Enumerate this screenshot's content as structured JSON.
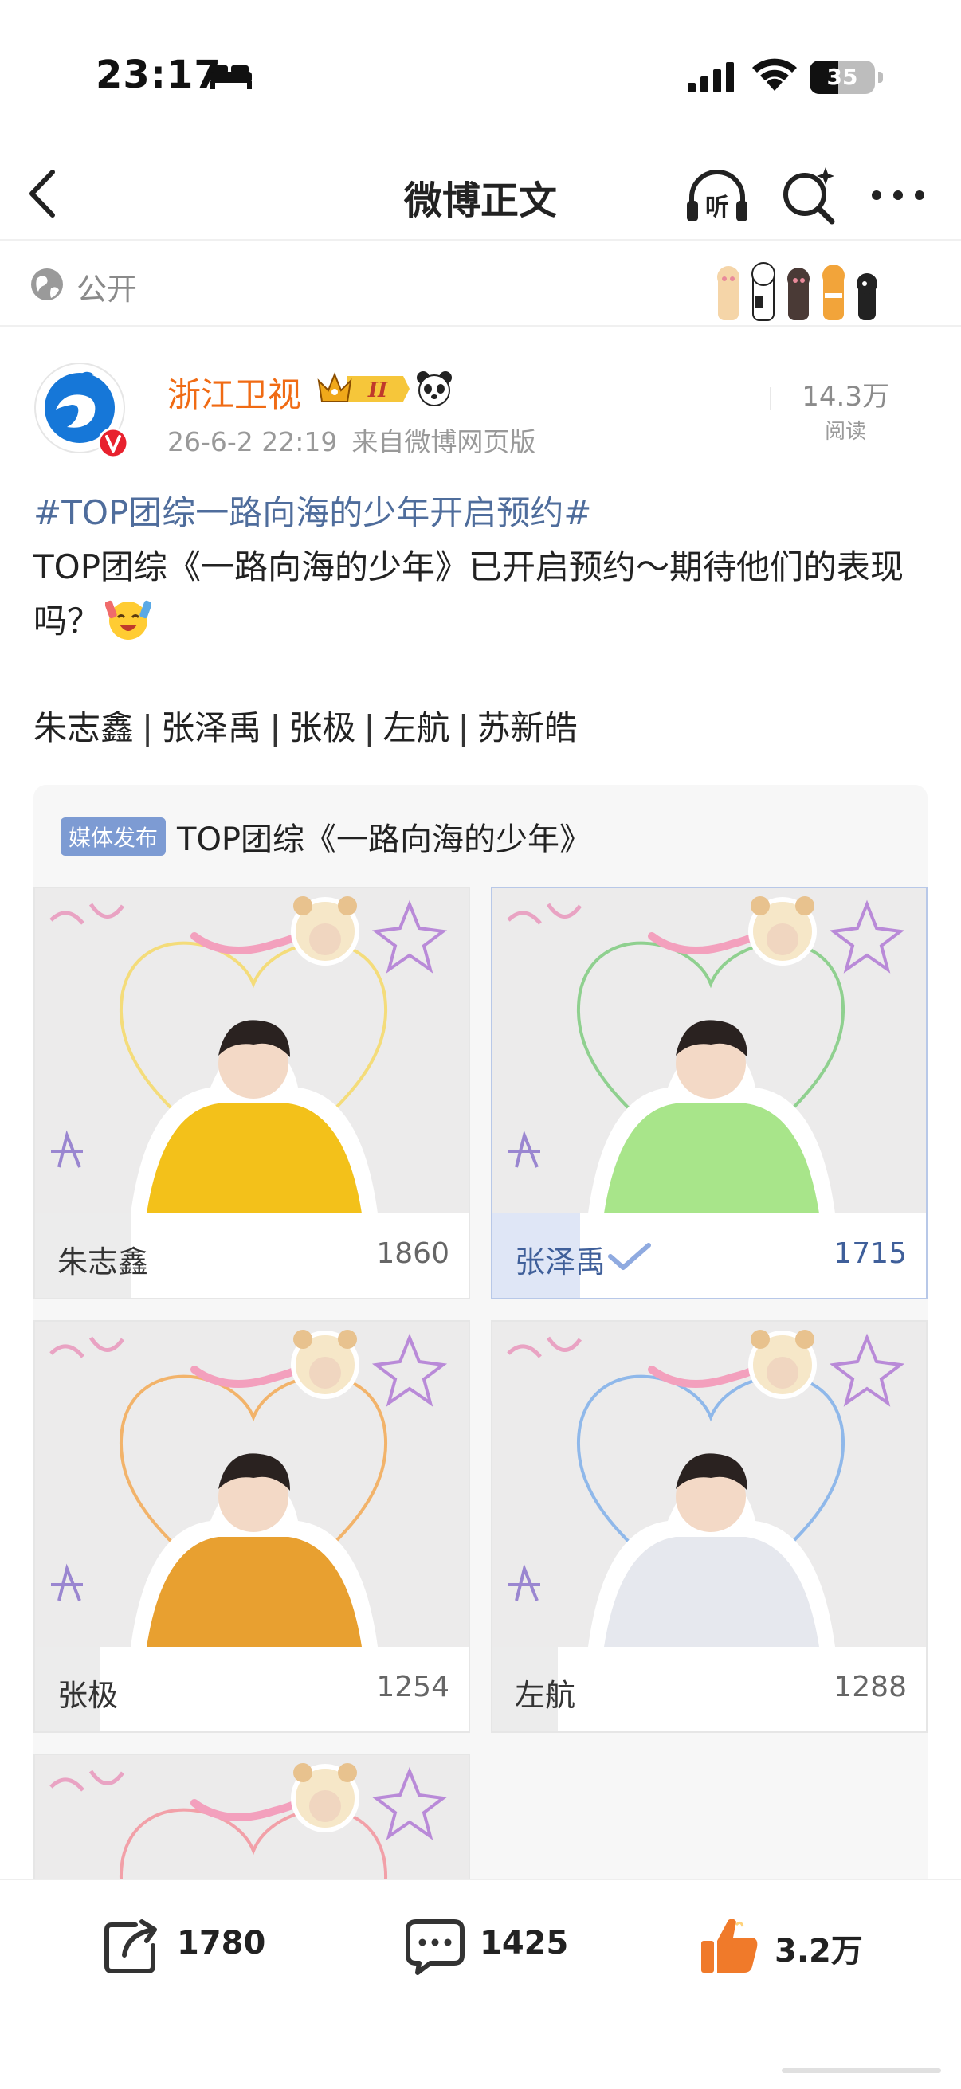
{
  "status_bar": {
    "time": "23:17",
    "battery": "35"
  },
  "nav": {
    "title": "微博正文",
    "back_icon": "chevron-left-icon",
    "listen_icon": "headphones-listen-icon",
    "listen_label": "听",
    "search_icon": "search-sparkle-icon",
    "more_icon": "more-dots-icon"
  },
  "visibility": {
    "label": "公开",
    "icon": "globe-icon"
  },
  "post": {
    "author": "浙江卫视",
    "level_badge": "II",
    "timestamp": "26-6-2 22:19",
    "source": "来自微博网页版",
    "views_number": "14.3万",
    "views_label": "阅读",
    "hashtag": "#TOP团综一路向海的少年开启预约#",
    "text": "TOP团综《一路向海的少年》已开启预约～期待他们的表现吗？",
    "names": [
      "朱志鑫",
      "张泽禹",
      "张极",
      "左航",
      "苏新皓"
    ],
    "name_separator": "|"
  },
  "card": {
    "badge": "媒体发布",
    "title": "TOP团综《一路向海的少年》",
    "options": [
      {
        "name": "朱志鑫",
        "count": "1860",
        "share": 0.22,
        "selected": false,
        "heart_color": "#f4dc7a",
        "shirt_color": "#f3c11a"
      },
      {
        "name": "张泽禹",
        "count": "1715",
        "share": 0.2,
        "selected": true,
        "heart_color": "#8fd08f",
        "shirt_color": "#a8e58a"
      },
      {
        "name": "张极",
        "count": "1254",
        "share": 0.15,
        "selected": false,
        "heart_color": "#f2b36a",
        "shirt_color": "#e8a030"
      },
      {
        "name": "左航",
        "count": "1288",
        "share": 0.15,
        "selected": false,
        "heart_color": "#8fb8ea",
        "shirt_color": "#e6e8ee"
      },
      {
        "name": "",
        "count": "",
        "share": 0,
        "selected": false,
        "heart_color": "#f2a0a8",
        "shirt_color": "#dddddd"
      }
    ]
  },
  "actions": {
    "share": {
      "icon": "share-icon",
      "count": "1780"
    },
    "comment": {
      "icon": "comment-icon",
      "count": "1425"
    },
    "like": {
      "icon": "thumbs-up-icon",
      "count": "3.2万"
    }
  },
  "colors": {
    "hashtag": "#4f6d9c",
    "username": "#f06b14",
    "badge": "#7d9bd3",
    "like": "#f07a2a"
  }
}
